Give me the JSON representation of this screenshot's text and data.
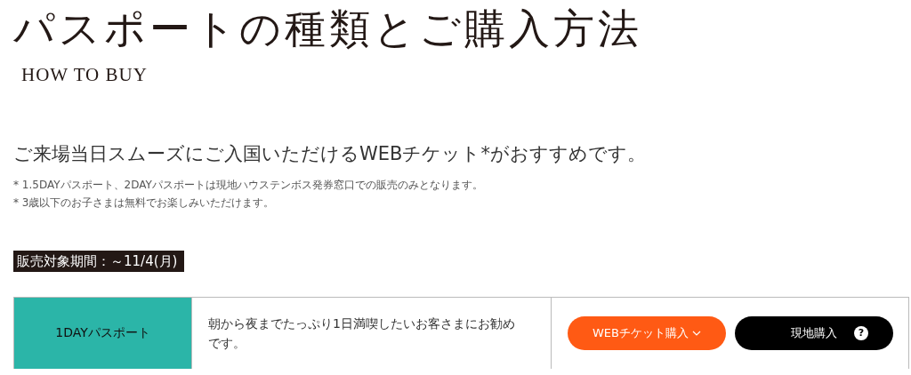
{
  "heading": {
    "title": "パスポートの種類とご購入方法",
    "subtitle": "HOW TO BUY"
  },
  "lead": "ご来場当日スムーズにご入国いただけるWEBチケット*がおすすめです。",
  "notes": [
    {
      "mark": "*",
      "text": "1.5DAYパスポート、2DAYパスポートは現地ハウステンボス発券窓口での販売のみとなります。"
    },
    {
      "mark": "*",
      "text": "3歳以下のお子さまは無料でお楽しみいただけます。"
    }
  ],
  "sale_period": "販売対象期間：～11/4(月)",
  "passes": [
    {
      "name": "1DAYパスポート",
      "description": "朝から夜までたっぷり1日満喫したいお客さまにお勧めです。",
      "web_button": "WEBチケット購入",
      "onsite_button": "現地購入",
      "help_icon": "?"
    }
  ]
}
